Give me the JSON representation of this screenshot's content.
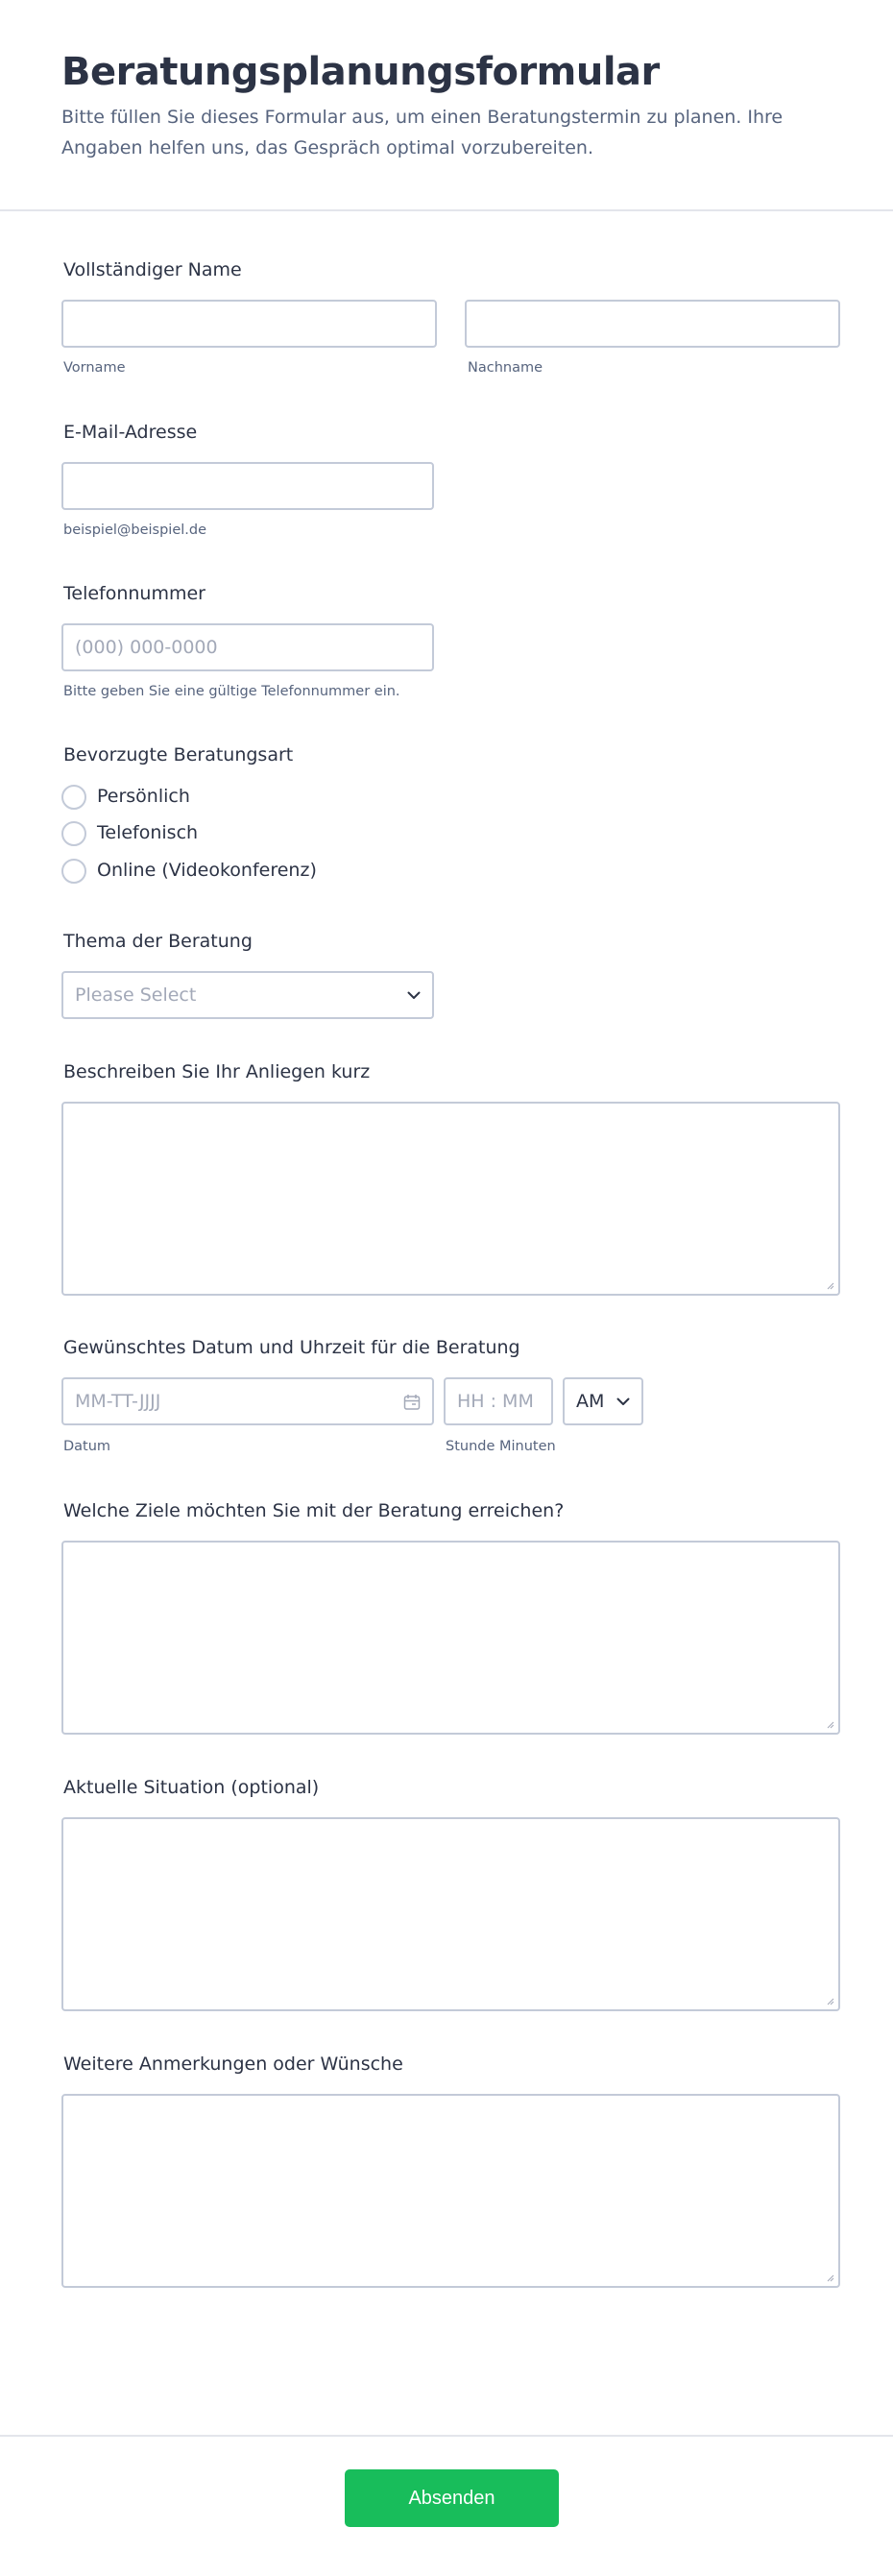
{
  "form": {
    "title": "Beratungsplanungsformular",
    "subtitle": "Bitte füllen Sie dieses Formular aus, um einen Beratungstermin zu planen. Ihre Angaben helfen uns, das Gespräch optimal vorzubereiten."
  },
  "name": {
    "label": "Vollständiger Name",
    "first_sublabel": "Vorname",
    "last_sublabel": "Nachname",
    "first_value": "",
    "last_value": ""
  },
  "email": {
    "label": "E-Mail-Adresse",
    "sublabel": "beispiel@beispiel.de",
    "value": ""
  },
  "phone": {
    "label": "Telefonnummer",
    "placeholder": "(000) 000-0000",
    "sublabel": "Bitte geben Sie eine gültige Telefonnummer ein."
  },
  "consult_type": {
    "label": "Bevorzugte Beratungsart",
    "options": [
      "Persönlich",
      "Telefonisch",
      "Online (Videokonferenz)"
    ]
  },
  "topic": {
    "label": "Thema der Beratung",
    "placeholder": "Please Select"
  },
  "concern": {
    "label": "Beschreiben Sie Ihr Anliegen kurz"
  },
  "datetime": {
    "label": "Gewünschtes Datum und Uhrzeit für die Beratung",
    "date_placeholder": "MM-TT-JJJJ",
    "time_placeholder": "HH : MM",
    "ampm_value": "AM",
    "date_sublabel": "Datum",
    "time_sublabel": "Stunde Minuten"
  },
  "goals": {
    "label": "Welche Ziele möchten Sie mit der Beratung erreichen?"
  },
  "situation": {
    "label": "Aktuelle Situation (optional)"
  },
  "remarks": {
    "label": "Weitere Anmerkungen oder Wünsche"
  },
  "submit": {
    "label": "Absenden"
  },
  "colors": {
    "accent": "#18bd5b",
    "title": "#2c3345",
    "muted": "#57647e",
    "border": "#c3cad8",
    "placeholder": "#a3a9b8"
  },
  "icons": {
    "select_chevron": "chevron-down-icon",
    "ampm_chevron": "chevron-down-icon",
    "calendar": "calendar-icon",
    "resize": "resize-handle-icon"
  }
}
